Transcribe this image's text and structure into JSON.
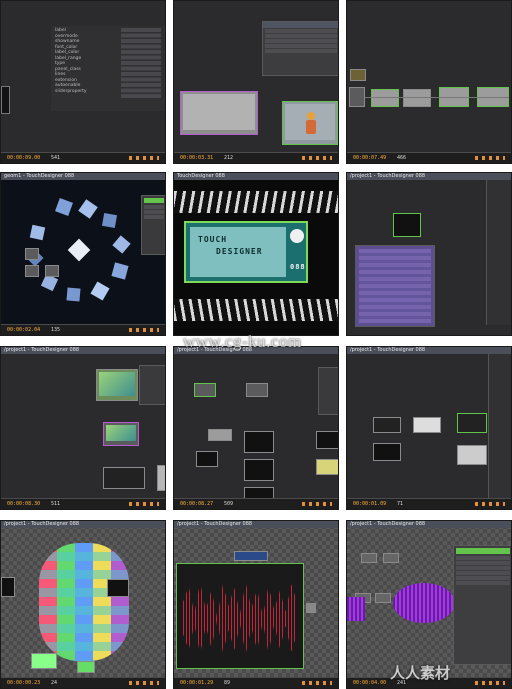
{
  "tiles": [
    {
      "timecode": "00:00:09.00",
      "frame": "541",
      "title": ""
    },
    {
      "timecode": "00:00:03.31",
      "frame": "212",
      "title": ""
    },
    {
      "timecode": "00:00:07.49",
      "frame": "466",
      "title": ""
    },
    {
      "timecode": "00:00:02.04",
      "frame": "135",
      "title": "geom1 - TouchDesigner 088"
    },
    {
      "timecode": "",
      "frame": "",
      "title": "TouchDesigner 088"
    },
    {
      "timecode": "",
      "frame": "",
      "title": "/project1 - TouchDesigner 088"
    },
    {
      "timecode": "00:00:08.30",
      "frame": "511",
      "title": "/project1 - TouchDesigner 088"
    },
    {
      "timecode": "00:00:08.27",
      "frame": "509",
      "title": "/project1 - TouchDesigner 088"
    },
    {
      "timecode": "00:00:01.09",
      "frame": "71",
      "title": "/project1 - TouchDesigner 088"
    },
    {
      "timecode": "00:00:00.23",
      "frame": "24",
      "title": "/project1 - TouchDesigner 088"
    },
    {
      "timecode": "00:00:01.29",
      "frame": "89",
      "title": "/project1 - TouchDesigner 088"
    },
    {
      "timecode": "00:00:04.00",
      "frame": "241",
      "title": "/project1 - TouchDesigner 088"
    }
  ],
  "banner": {
    "line1": "TOUCH",
    "line2": "DESIGNER",
    "version": "088"
  },
  "params_tile1": [
    "label",
    "overmode",
    "showname",
    "font_color",
    "label_color",
    "label_range",
    "type",
    "panel_class",
    "lines",
    "extension",
    "autoenable",
    "sliderproperty"
  ],
  "watermark": "www.cg-ku.com",
  "logo": "人人素材",
  "colors": {
    "accent_orange": "#ffb23e",
    "node_green": "#63c34a",
    "node_purple": "#b65dd6",
    "bg": "#2b2b2d"
  }
}
